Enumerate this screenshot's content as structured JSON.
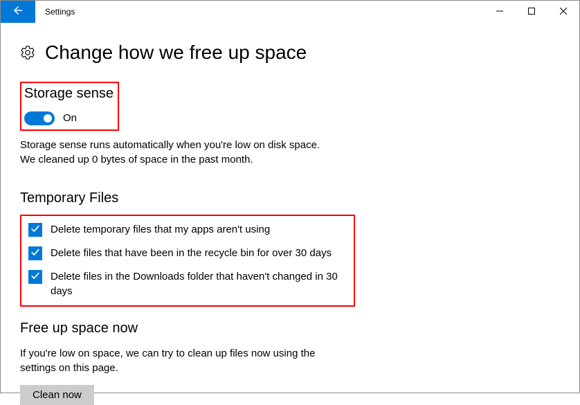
{
  "window": {
    "title": "Settings"
  },
  "page": {
    "title": "Change how we free up space"
  },
  "storageSense": {
    "heading": "Storage sense",
    "toggleState": "On",
    "descriptionLine1": "Storage sense runs automatically when you're low on disk space.",
    "descriptionLine2": "We cleaned up 0 bytes of space in the past month."
  },
  "temporaryFiles": {
    "heading": "Temporary Files",
    "options": [
      {
        "label": "Delete temporary files that my apps aren't using",
        "checked": true
      },
      {
        "label": "Delete files that have been in the recycle bin for over 30 days",
        "checked": true
      },
      {
        "label": "Delete files in the Downloads folder that haven't changed in 30 days",
        "checked": true
      }
    ]
  },
  "freeUpSpace": {
    "heading": "Free up space now",
    "description": "If you're low on space, we can try to clean up files now using the settings on this page.",
    "buttonLabel": "Clean now"
  }
}
